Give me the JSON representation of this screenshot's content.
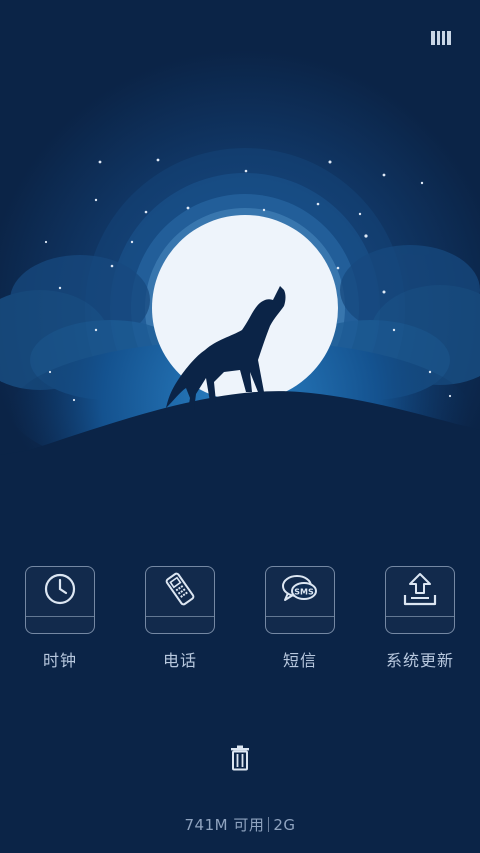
{
  "colors": {
    "background": "#0b2447",
    "moon": "#eef4fb",
    "label": "#b8c8de",
    "tile_border": "#c8d7eb"
  },
  "header": {
    "menu_icon": "menu-bars-icon"
  },
  "apps": [
    {
      "label": "时钟",
      "icon": "clock-icon"
    },
    {
      "label": "电话",
      "icon": "phone-icon"
    },
    {
      "label": "短信",
      "icon": "sms-icon"
    },
    {
      "label": "系统更新",
      "icon": "system-update-icon"
    }
  ],
  "footer": {
    "trash_icon": "trash-icon",
    "memory_available": "741M 可用",
    "memory_total": "2G"
  }
}
